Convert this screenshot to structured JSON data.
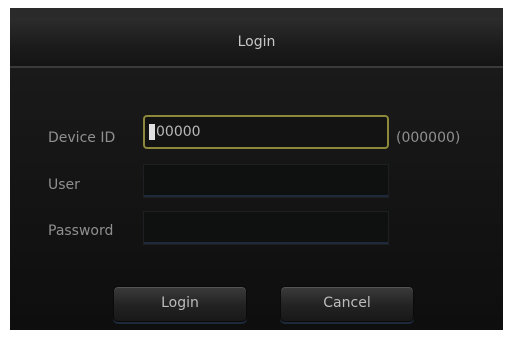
{
  "dialog": {
    "title": "Login",
    "fields": {
      "device_id": {
        "label": "Device ID",
        "value": "00000",
        "hint": "(000000)"
      },
      "user": {
        "label": "User",
        "value": ""
      },
      "password": {
        "label": "Password",
        "value": ""
      }
    },
    "buttons": {
      "login": "Login",
      "cancel": "Cancel"
    }
  },
  "colors": {
    "background": "#151515",
    "focus_border": "#8c8a3a",
    "text": "#8f8f8f"
  }
}
